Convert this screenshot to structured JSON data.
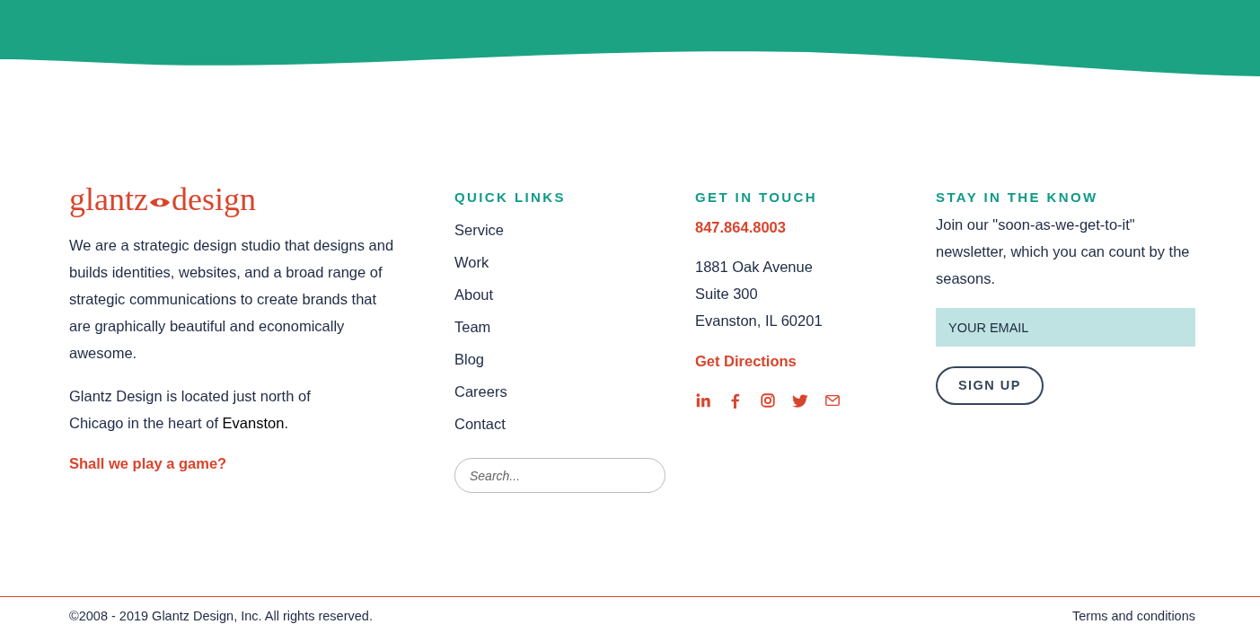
{
  "logo": {
    "left": "glantz",
    "right": "design"
  },
  "about": {
    "paragraph": "We are a strategic design studio that designs and builds identities, websites, and a broad range of strategic communications to create brands that are graphically beautiful and economically awesome.",
    "location": {
      "before": "Glantz Design is located just north of Chicago in the heart of ",
      "link": "Evanston",
      "after": "."
    },
    "game_link": "Shall we play a game?"
  },
  "quick_links": {
    "heading": "QUICK LINKS",
    "items": [
      "Service",
      "Work",
      "About",
      "Team",
      "Blog",
      "Careers",
      "Contact"
    ],
    "search": {
      "placeholder": "Search..."
    }
  },
  "contact": {
    "heading": "GET IN TOUCH",
    "phone": "847.864.8003",
    "address": [
      "1881 Oak Avenue",
      "Suite 300",
      "Evanston, IL 60201"
    ],
    "directions": "Get Directions",
    "social": [
      {
        "kind": "linkedin"
      },
      {
        "kind": "facebook"
      },
      {
        "kind": "instagram"
      },
      {
        "kind": "twitter"
      },
      {
        "kind": "email"
      }
    ]
  },
  "newsletter": {
    "heading": "STAY IN THE KNOW",
    "text": "Join our \"soon-as-we-get-to-it\" newsletter, which you can count by the seasons.",
    "email": {
      "placeholder": "YOUR EMAIL"
    },
    "button": "SIGN UP"
  },
  "bottom_bar": {
    "copyright": "©2008 - 2019 Glantz Design, Inc. All rights reserved.",
    "terms": "Terms and conditions"
  }
}
